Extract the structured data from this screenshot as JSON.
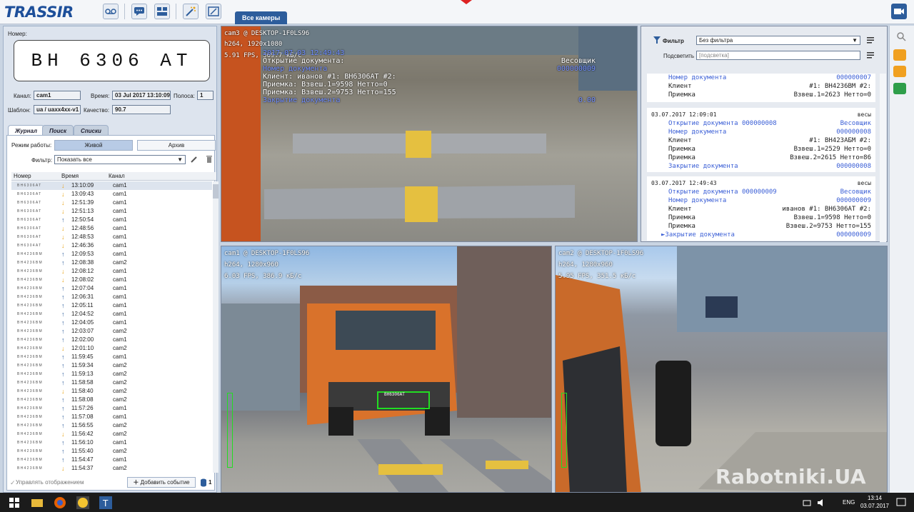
{
  "app": {
    "logo": "TRASSIR",
    "tab_all_cameras": "Все камеры"
  },
  "plate": {
    "label": "Номер:",
    "value": "BH 6306 AT"
  },
  "info": {
    "channel_label": "Канал:",
    "channel": "cam1",
    "time_label": "Время:",
    "time": "03 Jul 2017 13:10:09",
    "lane_label": "Полоса:",
    "lane": "1",
    "template_label": "Шаблон:",
    "template": "ua / uaxx4xx-v1",
    "quality_label": "Качество:",
    "quality": "90.7"
  },
  "tabs": [
    "Журнал",
    "Поиск",
    "Списки"
  ],
  "journal": {
    "mode_label": "Режим работы:",
    "mode_live": "Живой",
    "mode_archive": "Архив",
    "filter_label": "Фильтр:",
    "filter_value": "Показать все",
    "columns": [
      "Номер",
      "Время",
      "Канал"
    ],
    "rows": [
      {
        "n": "BH6306AT",
        "dir": "down",
        "t": "13:10:09",
        "c": "cam1"
      },
      {
        "n": "BH6306AT",
        "dir": "down",
        "t": "13:09:43",
        "c": "cam1"
      },
      {
        "n": "BH6306AT",
        "dir": "down",
        "t": "12:51:39",
        "c": "cam1"
      },
      {
        "n": "BH6306AT",
        "dir": "down",
        "t": "12:51:13",
        "c": "cam1"
      },
      {
        "n": "BH6306AT",
        "dir": "up",
        "t": "12:50:54",
        "c": "cam1"
      },
      {
        "n": "BH6306AT",
        "dir": "down",
        "t": "12:48:56",
        "c": "cam1"
      },
      {
        "n": "BH6306AT",
        "dir": "down",
        "t": "12:48:53",
        "c": "cam1"
      },
      {
        "n": "BH6304AT",
        "dir": "down",
        "t": "12:46:36",
        "c": "cam1"
      },
      {
        "n": "BH4236BM",
        "dir": "up",
        "t": "12:09:53",
        "c": "cam1"
      },
      {
        "n": "BH4236BM",
        "dir": "up",
        "t": "12:08:38",
        "c": "cam2"
      },
      {
        "n": "BH4236BM",
        "dir": "down",
        "t": "12:08:12",
        "c": "cam1"
      },
      {
        "n": "BH4236BM",
        "dir": "down",
        "t": "12:08:02",
        "c": "cam1"
      },
      {
        "n": "BH4236BM",
        "dir": "up",
        "t": "12:07:04",
        "c": "cam1"
      },
      {
        "n": "BH4236BM",
        "dir": "up",
        "t": "12:06:31",
        "c": "cam1"
      },
      {
        "n": "BH4236BM",
        "dir": "up",
        "t": "12:05:11",
        "c": "cam1"
      },
      {
        "n": "BH4236BM",
        "dir": "up",
        "t": "12:04:52",
        "c": "cam1"
      },
      {
        "n": "BH4236BM",
        "dir": "up",
        "t": "12:04:05",
        "c": "cam1"
      },
      {
        "n": "BH4236BM",
        "dir": "up",
        "t": "12:03:07",
        "c": "cam2"
      },
      {
        "n": "BH4236BM",
        "dir": "up",
        "t": "12:02:00",
        "c": "cam1"
      },
      {
        "n": "BH4236BM",
        "dir": "down",
        "t": "12:01:10",
        "c": "cam2"
      },
      {
        "n": "BH4236BM",
        "dir": "up",
        "t": "11:59:45",
        "c": "cam1"
      },
      {
        "n": "BH4236BM",
        "dir": "up",
        "t": "11:59:34",
        "c": "cam2"
      },
      {
        "n": "BH4236BM",
        "dir": "up",
        "t": "11:59:13",
        "c": "cam2"
      },
      {
        "n": "BH4236BM",
        "dir": "up",
        "t": "11:58:58",
        "c": "cam2"
      },
      {
        "n": "BH4236BM",
        "dir": "down",
        "t": "11:58:40",
        "c": "cam2"
      },
      {
        "n": "BH4236BM",
        "dir": "up",
        "t": "11:58:08",
        "c": "cam2"
      },
      {
        "n": "BH4236BM",
        "dir": "up",
        "t": "11:57:26",
        "c": "cam1"
      },
      {
        "n": "BH4236BM",
        "dir": "up",
        "t": "11:57:08",
        "c": "cam1"
      },
      {
        "n": "BH4236BM",
        "dir": "up",
        "t": "11:56:55",
        "c": "cam2"
      },
      {
        "n": "BH4236BM",
        "dir": "down",
        "t": "11:56:42",
        "c": "cam2"
      },
      {
        "n": "BH4236BM",
        "dir": "up",
        "t": "11:56:10",
        "c": "cam1"
      },
      {
        "n": "BH4236BM",
        "dir": "up",
        "t": "11:55:40",
        "c": "cam2"
      },
      {
        "n": "BH4236BM",
        "dir": "up",
        "t": "11:54:47",
        "c": "cam1"
      },
      {
        "n": "BH4236BM",
        "dir": "down",
        "t": "11:54:37",
        "c": "cam2"
      }
    ],
    "manage_label": "Управлять отображением",
    "add_event": "Добавить событие",
    "count": "1"
  },
  "cam3": {
    "osd_title": "cam3 @ DESKTOP-1F0LS96",
    "osd_codec": "h264, 1920x1080",
    "osd_fps": "5.91 FPS, 369.7 кБ/с",
    "overlay": [
      {
        "text": "2017-07-03 12:49:43",
        "blue": true
      },
      {
        "text": "Открытие документа:",
        "blue": false,
        "right": "Весовщик"
      },
      {
        "text": "Номер документа",
        "blue": true,
        "right": "000000009"
      },
      {
        "text": "Клиент: иванов #1: BH6306AT #2:",
        "blue": false
      },
      {
        "text": "Приемка: Взвеш.1=9598 Нетто=0",
        "blue": false
      },
      {
        "text": "Приемка: Взвеш.2=9753 Нетто=155",
        "blue": false
      },
      {
        "text": "Закрытие документа",
        "blue": true,
        "right": "0.00"
      }
    ]
  },
  "cam1": {
    "osd_title": "cam1 @ DESKTOP-1F0LS96",
    "osd_codec": "h264, 1280x960",
    "osd_fps": "6.03 FPS, 386.9 кБ/с",
    "plate_text": "BH6306AT"
  },
  "cam2": {
    "osd_title": "cam2 @ DESKTOP-1F0LS96",
    "osd_codec": "h264, 1280x960",
    "osd_fps": "5.95 FPS, 351.5 кБ/с"
  },
  "receipts": {
    "filter_label": "Фильтр",
    "filter_value": "Без фильтра",
    "highlight_label": "Подсветить",
    "highlight_placeholder": "[подсветка]",
    "slip1": [
      {
        "l": "Номер документа",
        "r": "000000007",
        "blue": true
      },
      {
        "l": "Клиент",
        "r": "#1: BH4236BM #2:",
        "blue": false
      },
      {
        "l": "Приемка",
        "r": "Взвеш.1=2623 Нетто=0",
        "blue": false
      }
    ],
    "slip2_header": {
      "l": "03.07.2017 12:09:01",
      "r": "весы"
    },
    "slip2": [
      {
        "l": "Открытие документа 000000008",
        "r": "Весовщик",
        "blue": true
      },
      {
        "l": "Номер документа",
        "r": "000000008",
        "blue": true
      },
      {
        "l": "Клиент",
        "r": "#1: BH423АБМ #2:",
        "blue": false
      },
      {
        "l": "Приемка",
        "r": "Взвеш.1=2529 Нетто=0",
        "blue": false
      },
      {
        "l": "Приемка",
        "r": "Взвеш.2=2615 Нетто=86",
        "blue": false
      },
      {
        "l": "Закрытие документа",
        "r": "000000008",
        "blue": true
      }
    ],
    "slip3_header": {
      "l": "03.07.2017 12:49:43",
      "r": "весы"
    },
    "slip3": [
      {
        "l": "Открытие документа 000000009",
        "r": "Весовщик",
        "blue": true
      },
      {
        "l": "Номер документа",
        "r": "000000009",
        "blue": true
      },
      {
        "l": "Клиент",
        "r": "иванов #1: BH6306AT #2:",
        "blue": false
      },
      {
        "l": "Приемка",
        "r": "Взвеш.1=9598 Нетто=0",
        "blue": false
      },
      {
        "l": "Приемка",
        "r": "Взвеш.2=9753 Нетто=155",
        "blue": false
      },
      {
        "l": "►Закрытие документа",
        "r": "000000009",
        "blue": true
      }
    ]
  },
  "taskbar": {
    "lang": "ENG",
    "time": "13:14",
    "date": "03.07.2017"
  },
  "watermark": "Rabotniki.UA",
  "colors": {
    "accent": "#2d5d9c",
    "osd_blue": "#3b5fd6",
    "arrow_up": "#2d5d9c",
    "arrow_down": "#e8a317",
    "plate_frame": "#22dd22"
  }
}
